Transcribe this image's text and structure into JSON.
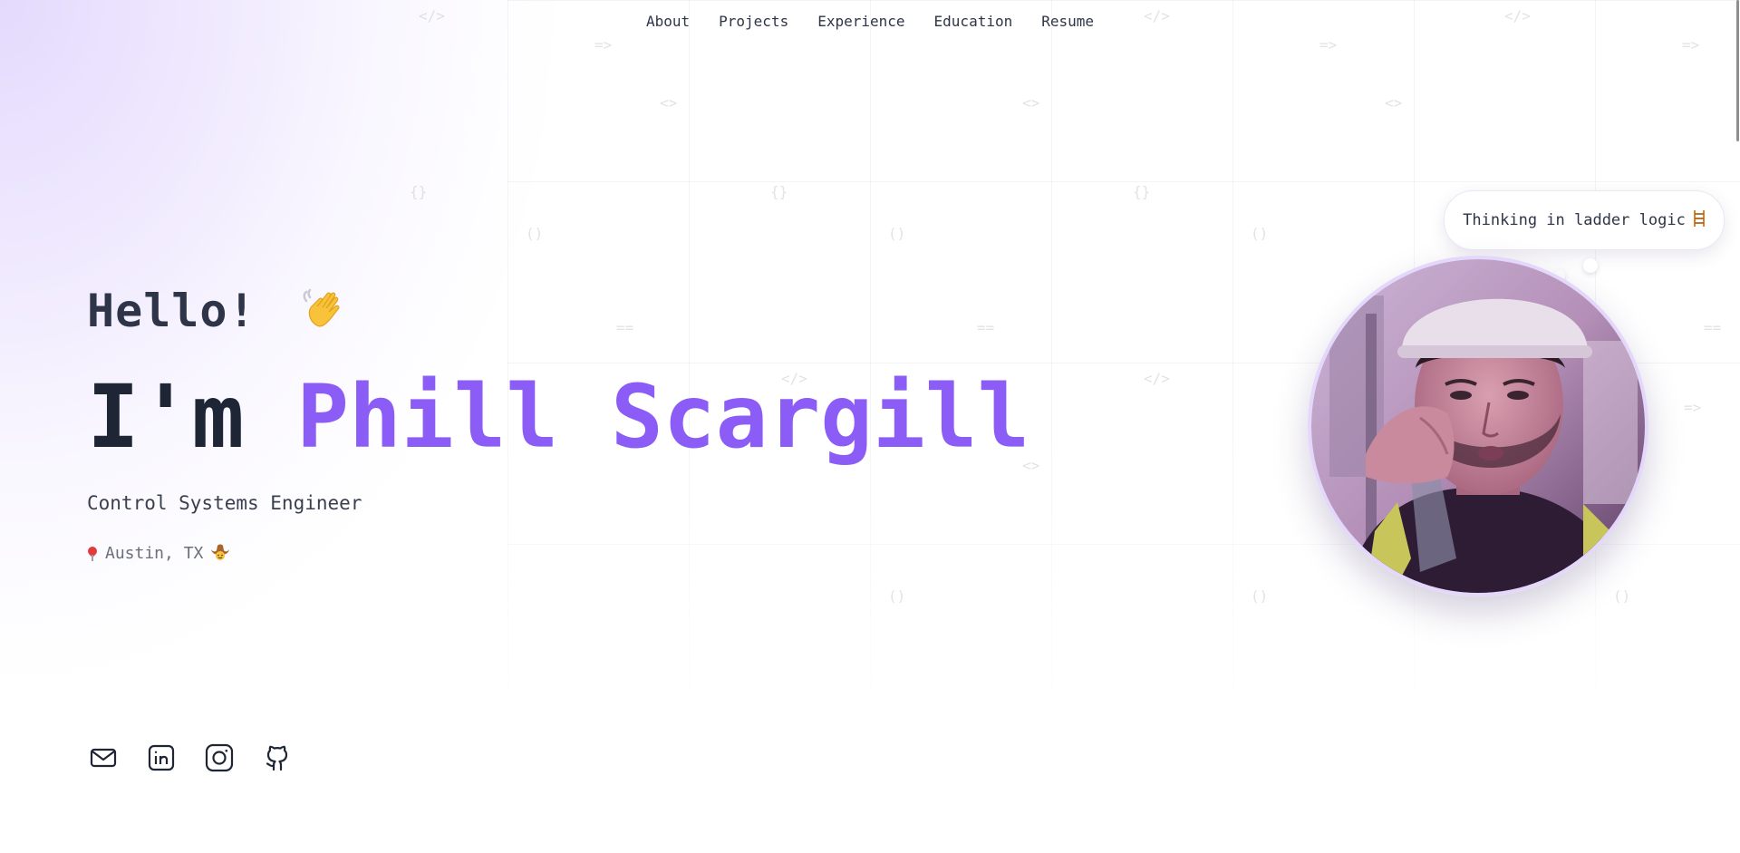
{
  "nav": {
    "items": [
      {
        "label": "About"
      },
      {
        "label": "Projects"
      },
      {
        "label": "Experience"
      },
      {
        "label": "Education"
      },
      {
        "label": "Resume"
      }
    ]
  },
  "hero": {
    "greeting": "Hello!",
    "title_prefix": "I'm",
    "name": "Phill Scargill",
    "subtitle": "Control Systems Engineer",
    "location": "Austin, TX"
  },
  "bubble": {
    "text": "Thinking in ladder logic"
  },
  "socials": [
    {
      "icon": "mail-icon"
    },
    {
      "icon": "linkedin-icon"
    },
    {
      "icon": "instagram-icon"
    },
    {
      "icon": "github-icon"
    }
  ],
  "colors": {
    "accent": "#8b5cf6",
    "text_dark": "#1e2635",
    "text_muted": "#6b6f7c",
    "avatar_border": "#e3d8fb"
  },
  "background_glyphs": [
    "</>",
    "=>",
    "<>",
    "{}",
    "()",
    "==",
    "</>",
    "=>",
    "<>"
  ]
}
